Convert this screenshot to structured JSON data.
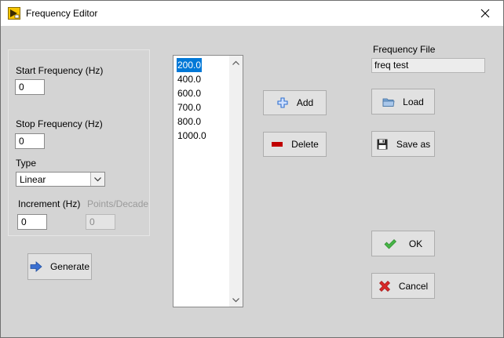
{
  "window": {
    "title": "Frequency Editor"
  },
  "range": {
    "start_label": "Start Frequency (Hz)",
    "start_value": "0",
    "stop_label": "Stop Frequency (Hz)",
    "stop_value": "0",
    "type_label": "Type",
    "type_value": "Linear",
    "increment_label": "Increment (Hz)",
    "increment_value": "0",
    "points_label": "Points/Decade",
    "points_value": "0"
  },
  "buttons": {
    "generate": "Generate",
    "add": "Add",
    "delete": "Delete",
    "load": "Load",
    "save_as": "Save as",
    "ok": "OK",
    "cancel": "Cancel"
  },
  "frequencies": [
    "200.0",
    "400.0",
    "600.0",
    "700.0",
    "800.0",
    "1000.0"
  ],
  "selected_frequency": "200.0",
  "file": {
    "label": "Frequency File",
    "value": "freq test"
  },
  "colors": {
    "selection": "#0078d7",
    "add_icon": "#2f6fcf",
    "delete_icon": "#c00000",
    "ok_icon": "#3aa53a",
    "cancel_icon": "#d42626"
  },
  "icons": {
    "app": "labview-icon",
    "close": "close-icon",
    "generate": "arrow-right-icon",
    "add": "plus-icon",
    "delete": "minus-icon",
    "load": "folder-icon",
    "save_as": "floppy-disk-icon",
    "ok": "checkmark-icon",
    "cancel": "x-icon"
  }
}
